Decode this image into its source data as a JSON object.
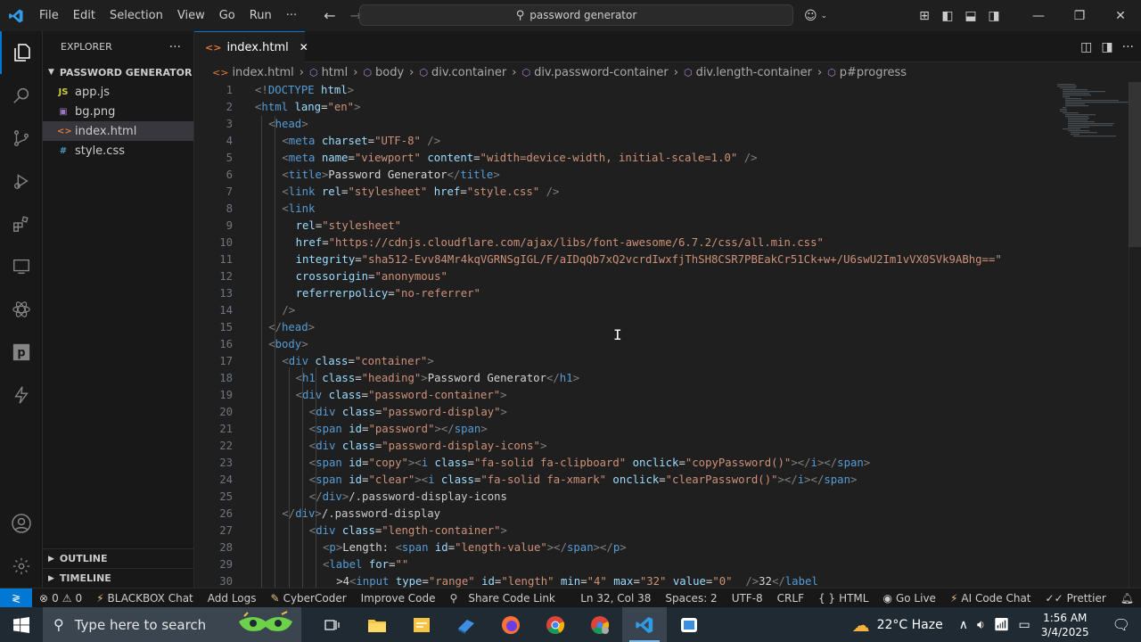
{
  "titlebar": {
    "menu": [
      "File",
      "Edit",
      "Selection",
      "View",
      "Go",
      "Run",
      "···"
    ],
    "search": "password generator"
  },
  "sidebar": {
    "header": "EXPLORER",
    "more": "···",
    "folder": "PASSWORD GENERATOR",
    "files": [
      {
        "icon": "JS",
        "name": "app.js",
        "color": "#cbcb41"
      },
      {
        "icon": "▣",
        "name": "bg.png",
        "color": "#a074c4"
      },
      {
        "icon": "<>",
        "name": "index.html",
        "color": "#e37933"
      },
      {
        "icon": "#",
        "name": "style.css",
        "color": "#519aba"
      }
    ],
    "outline": "OUTLINE",
    "timeline": "TIMELINE"
  },
  "tab": {
    "icon": "<>",
    "name": "index.html",
    "close": "✕"
  },
  "breadcrumb": [
    {
      "icon": "<>",
      "label": "index.html"
    },
    {
      "icon": "⬡",
      "label": "html"
    },
    {
      "icon": "⬡",
      "label": "body"
    },
    {
      "icon": "⬡",
      "label": "div.container"
    },
    {
      "icon": "⬡",
      "label": "div.password-container"
    },
    {
      "icon": "⬡",
      "label": "div.length-container"
    },
    {
      "icon": "⬡",
      "label": "p#progress"
    }
  ],
  "code_lines": [
    {
      "n": "1",
      "indent": 0,
      "tokens": [
        [
          "br",
          "<!"
        ],
        [
          "tg",
          "DOCTYPE"
        ],
        [
          "tx",
          " "
        ],
        [
          "at",
          "html"
        ],
        [
          "br",
          ">"
        ]
      ]
    },
    {
      "n": "2",
      "indent": 0,
      "tokens": [
        [
          "br",
          "<"
        ],
        [
          "tg",
          "html"
        ],
        [
          "tx",
          " "
        ],
        [
          "at",
          "lang"
        ],
        [
          "tx",
          "="
        ],
        [
          "st",
          "\"en\""
        ],
        [
          "br",
          ">"
        ]
      ]
    },
    {
      "n": "3",
      "indent": 1,
      "tokens": [
        [
          "br",
          "<"
        ],
        [
          "tg",
          "head"
        ],
        [
          "br",
          ">"
        ]
      ]
    },
    {
      "n": "4",
      "indent": 2,
      "tokens": [
        [
          "br",
          "<"
        ],
        [
          "tg",
          "meta"
        ],
        [
          "tx",
          " "
        ],
        [
          "at",
          "charset"
        ],
        [
          "tx",
          "="
        ],
        [
          "st",
          "\"UTF-8\""
        ],
        [
          "tx",
          " "
        ],
        [
          "br",
          "/>"
        ]
      ]
    },
    {
      "n": "5",
      "indent": 2,
      "tokens": [
        [
          "br",
          "<"
        ],
        [
          "tg",
          "meta"
        ],
        [
          "tx",
          " "
        ],
        [
          "at",
          "name"
        ],
        [
          "tx",
          "="
        ],
        [
          "st",
          "\"viewport\""
        ],
        [
          "tx",
          " "
        ],
        [
          "at",
          "content"
        ],
        [
          "tx",
          "="
        ],
        [
          "st",
          "\"width=device-width, initial-scale=1.0\""
        ],
        [
          "tx",
          " "
        ],
        [
          "br",
          "/>"
        ]
      ]
    },
    {
      "n": "6",
      "indent": 2,
      "tokens": [
        [
          "br",
          "<"
        ],
        [
          "tg",
          "title"
        ],
        [
          "br",
          ">"
        ],
        [
          "tx",
          "Password Generator"
        ],
        [
          "br",
          "</"
        ],
        [
          "tg",
          "title"
        ],
        [
          "br",
          ">"
        ]
      ]
    },
    {
      "n": "7",
      "indent": 2,
      "tokens": [
        [
          "br",
          "<"
        ],
        [
          "tg",
          "link"
        ],
        [
          "tx",
          " "
        ],
        [
          "at",
          "rel"
        ],
        [
          "tx",
          "="
        ],
        [
          "st",
          "\"stylesheet\""
        ],
        [
          "tx",
          " "
        ],
        [
          "at",
          "href"
        ],
        [
          "tx",
          "="
        ],
        [
          "st",
          "\"style.css\""
        ],
        [
          "tx",
          " "
        ],
        [
          "br",
          "/>"
        ]
      ]
    },
    {
      "n": "8",
      "indent": 2,
      "tokens": [
        [
          "br",
          "<"
        ],
        [
          "tg",
          "link"
        ]
      ]
    },
    {
      "n": "9",
      "indent": 3,
      "tokens": [
        [
          "at",
          "rel"
        ],
        [
          "tx",
          "="
        ],
        [
          "st",
          "\"stylesheet\""
        ]
      ]
    },
    {
      "n": "10",
      "indent": 3,
      "tokens": [
        [
          "at",
          "href"
        ],
        [
          "tx",
          "="
        ],
        [
          "st",
          "\"https://cdnjs.cloudflare.com/ajax/libs/font-awesome/6.7.2/css/all.min.css\""
        ]
      ]
    },
    {
      "n": "11",
      "indent": 3,
      "tokens": [
        [
          "at",
          "integrity"
        ],
        [
          "tx",
          "="
        ],
        [
          "st",
          "\"sha512-Evv84Mr4kqVGRNSgIGL/F/aIDqQb7xQ2vcrdIwxfjThSH8CSR7PBEakCr51Ck+w+/U6swU2Im1vVX0SVk9ABhg==\""
        ]
      ]
    },
    {
      "n": "12",
      "indent": 3,
      "tokens": [
        [
          "at",
          "crossorigin"
        ],
        [
          "tx",
          "="
        ],
        [
          "st",
          "\"anonymous\""
        ]
      ]
    },
    {
      "n": "13",
      "indent": 3,
      "tokens": [
        [
          "at",
          "referrerpolicy"
        ],
        [
          "tx",
          "="
        ],
        [
          "st",
          "\"no-referrer\""
        ]
      ]
    },
    {
      "n": "14",
      "indent": 2,
      "tokens": [
        [
          "br",
          "/>"
        ]
      ]
    },
    {
      "n": "15",
      "indent": 1,
      "tokens": [
        [
          "br",
          "</"
        ],
        [
          "tg",
          "head"
        ],
        [
          "br",
          ">"
        ]
      ]
    },
    {
      "n": "16",
      "indent": 1,
      "tokens": [
        [
          "br",
          "<"
        ],
        [
          "tg",
          "body"
        ],
        [
          "br",
          ">"
        ]
      ]
    },
    {
      "n": "17",
      "indent": 2,
      "tokens": [
        [
          "br",
          "<"
        ],
        [
          "tg",
          "div"
        ],
        [
          "tx",
          " "
        ],
        [
          "at",
          "class"
        ],
        [
          "tx",
          "="
        ],
        [
          "st",
          "\"container\""
        ],
        [
          "br",
          ">"
        ]
      ]
    },
    {
      "n": "18",
      "indent": 3,
      "tokens": [
        [
          "br",
          "<"
        ],
        [
          "tg",
          "h1"
        ],
        [
          "tx",
          " "
        ],
        [
          "at",
          "class"
        ],
        [
          "tx",
          "="
        ],
        [
          "st",
          "\"heading\""
        ],
        [
          "br",
          ">"
        ],
        [
          "tx",
          "Password Generator"
        ],
        [
          "br",
          "</"
        ],
        [
          "tg",
          "h1"
        ],
        [
          "br",
          ">"
        ]
      ]
    },
    {
      "n": "19",
      "indent": 3,
      "tokens": [
        [
          "br",
          "<"
        ],
        [
          "tg",
          "div"
        ],
        [
          "tx",
          " "
        ],
        [
          "at",
          "class"
        ],
        [
          "tx",
          "="
        ],
        [
          "st",
          "\"password-container\""
        ],
        [
          "br",
          ">"
        ]
      ]
    },
    {
      "n": "20",
      "indent": 4,
      "tokens": [
        [
          "br",
          "<"
        ],
        [
          "tg",
          "div"
        ],
        [
          "tx",
          " "
        ],
        [
          "at",
          "class"
        ],
        [
          "tx",
          "="
        ],
        [
          "st",
          "\"password-display\""
        ],
        [
          "br",
          ">"
        ]
      ]
    },
    {
      "n": "21",
      "indent": 4,
      "tokens": [
        [
          "br",
          "<"
        ],
        [
          "tg",
          "span"
        ],
        [
          "tx",
          " "
        ],
        [
          "at",
          "id"
        ],
        [
          "tx",
          "="
        ],
        [
          "st",
          "\"password\""
        ],
        [
          "br",
          "></"
        ],
        [
          "tg",
          "span"
        ],
        [
          "br",
          ">"
        ]
      ]
    },
    {
      "n": "22",
      "indent": 4,
      "tokens": [
        [
          "br",
          "<"
        ],
        [
          "tg",
          "div"
        ],
        [
          "tx",
          " "
        ],
        [
          "at",
          "class"
        ],
        [
          "tx",
          "="
        ],
        [
          "st",
          "\"password-display-icons\""
        ],
        [
          "br",
          ">"
        ]
      ]
    },
    {
      "n": "23",
      "indent": 4,
      "tokens": [
        [
          "br",
          "<"
        ],
        [
          "tg",
          "span"
        ],
        [
          "tx",
          " "
        ],
        [
          "at",
          "id"
        ],
        [
          "tx",
          "="
        ],
        [
          "st",
          "\"copy\""
        ],
        [
          "br",
          "><"
        ],
        [
          "tg",
          "i"
        ],
        [
          "tx",
          " "
        ],
        [
          "at",
          "class"
        ],
        [
          "tx",
          "="
        ],
        [
          "st",
          "\"fa-solid fa-clipboard\""
        ],
        [
          "tx",
          " "
        ],
        [
          "at",
          "onclick"
        ],
        [
          "tx",
          "="
        ],
        [
          "st",
          "\"copyPassword()\""
        ],
        [
          "br",
          "></"
        ],
        [
          "tg",
          "i"
        ],
        [
          "br",
          "></"
        ],
        [
          "tg",
          "span"
        ],
        [
          "br",
          ">"
        ]
      ]
    },
    {
      "n": "24",
      "indent": 4,
      "tokens": [
        [
          "br",
          "<"
        ],
        [
          "tg",
          "span"
        ],
        [
          "tx",
          " "
        ],
        [
          "at",
          "id"
        ],
        [
          "tx",
          "="
        ],
        [
          "st",
          "\"clear\""
        ],
        [
          "br",
          "><"
        ],
        [
          "tg",
          "i"
        ],
        [
          "tx",
          " "
        ],
        [
          "at",
          "class"
        ],
        [
          "tx",
          "="
        ],
        [
          "st",
          "\"fa-solid fa-xmark\""
        ],
        [
          "tx",
          " "
        ],
        [
          "at",
          "onclick"
        ],
        [
          "tx",
          "="
        ],
        [
          "st",
          "\"clearPassword()\""
        ],
        [
          "br",
          "></"
        ],
        [
          "tg",
          "i"
        ],
        [
          "br",
          "></"
        ],
        [
          "tg",
          "span"
        ],
        [
          "br",
          ">"
        ]
      ]
    },
    {
      "n": "25",
      "indent": 4,
      "tokens": [
        [
          "br",
          "</"
        ],
        [
          "tg",
          "div"
        ],
        [
          "br",
          ">"
        ],
        [
          "cm",
          "/.password-display-icons"
        ]
      ]
    },
    {
      "n": "26",
      "indent": 2,
      "tokens": [
        [
          "br",
          "</"
        ],
        [
          "tg",
          "div"
        ],
        [
          "br",
          ">"
        ],
        [
          "cm",
          "/.password-display"
        ]
      ]
    },
    {
      "n": "27",
      "indent": 4,
      "tokens": [
        [
          "br",
          "<"
        ],
        [
          "tg",
          "div"
        ],
        [
          "tx",
          " "
        ],
        [
          "at",
          "class"
        ],
        [
          "tx",
          "="
        ],
        [
          "st",
          "\"length-container\""
        ],
        [
          "br",
          ">"
        ]
      ]
    },
    {
      "n": "28",
      "indent": 5,
      "tokens": [
        [
          "br",
          "<"
        ],
        [
          "tg",
          "p"
        ],
        [
          "br",
          ">"
        ],
        [
          "tx",
          "Length: "
        ],
        [
          "br",
          "<"
        ],
        [
          "tg",
          "span"
        ],
        [
          "tx",
          " "
        ],
        [
          "at",
          "id"
        ],
        [
          "tx",
          "="
        ],
        [
          "st",
          "\"length-value\""
        ],
        [
          "br",
          "></"
        ],
        [
          "tg",
          "span"
        ],
        [
          "br",
          "></"
        ],
        [
          "tg",
          "p"
        ],
        [
          "br",
          ">"
        ]
      ]
    },
    {
      "n": "29",
      "indent": 5,
      "tokens": [
        [
          "br",
          "<"
        ],
        [
          "tg",
          "label"
        ],
        [
          "tx",
          " "
        ],
        [
          "at",
          "for"
        ],
        [
          "tx",
          "="
        ],
        [
          "st",
          "\"\""
        ]
      ]
    },
    {
      "n": "30",
      "indent": 6,
      "tokens": [
        [
          "tx",
          ">4"
        ],
        [
          "br",
          "<"
        ],
        [
          "tg",
          "input"
        ],
        [
          "tx",
          " "
        ],
        [
          "at",
          "type"
        ],
        [
          "tx",
          "="
        ],
        [
          "st",
          "\"range\""
        ],
        [
          "tx",
          " "
        ],
        [
          "at",
          "id"
        ],
        [
          "tx",
          "="
        ],
        [
          "st",
          "\"length\""
        ],
        [
          "tx",
          " "
        ],
        [
          "at",
          "min"
        ],
        [
          "tx",
          "="
        ],
        [
          "st",
          "\"4\""
        ],
        [
          "tx",
          " "
        ],
        [
          "at",
          "max"
        ],
        [
          "tx",
          "="
        ],
        [
          "st",
          "\"32\""
        ],
        [
          "tx",
          " "
        ],
        [
          "at",
          "value"
        ],
        [
          "tx",
          "="
        ],
        [
          "st",
          "\"0\""
        ],
        [
          "tx",
          "  "
        ],
        [
          "br",
          "/>"
        ],
        [
          "tx",
          "32"
        ],
        [
          "br",
          "</"
        ],
        [
          "tg",
          "label"
        ]
      ]
    }
  ],
  "statusbar": {
    "errors": "0",
    "warnings": "0",
    "blackbox": "BLACKBOX Chat",
    "add_logs": "Add Logs",
    "cybercoder": "CyberCoder",
    "improve": "Improve Code",
    "share": "Share Code Link",
    "position": "Ln 32, Col 38",
    "spaces": "Spaces: 2",
    "encoding": "UTF-8",
    "eol": "CRLF",
    "brace": "{ }",
    "language": "HTML",
    "golive": "Go Live",
    "aichat": "AI Code Chat",
    "prettier": "Prettier"
  },
  "taskbar": {
    "search_placeholder": "Type here to search",
    "weather": "22°C  Haze",
    "time": "1:56 AM",
    "date": "3/4/2025"
  },
  "colors": {
    "accent": "#0078d4",
    "editor_bg": "#1f1f1f",
    "sidebar_bg": "#181818"
  }
}
